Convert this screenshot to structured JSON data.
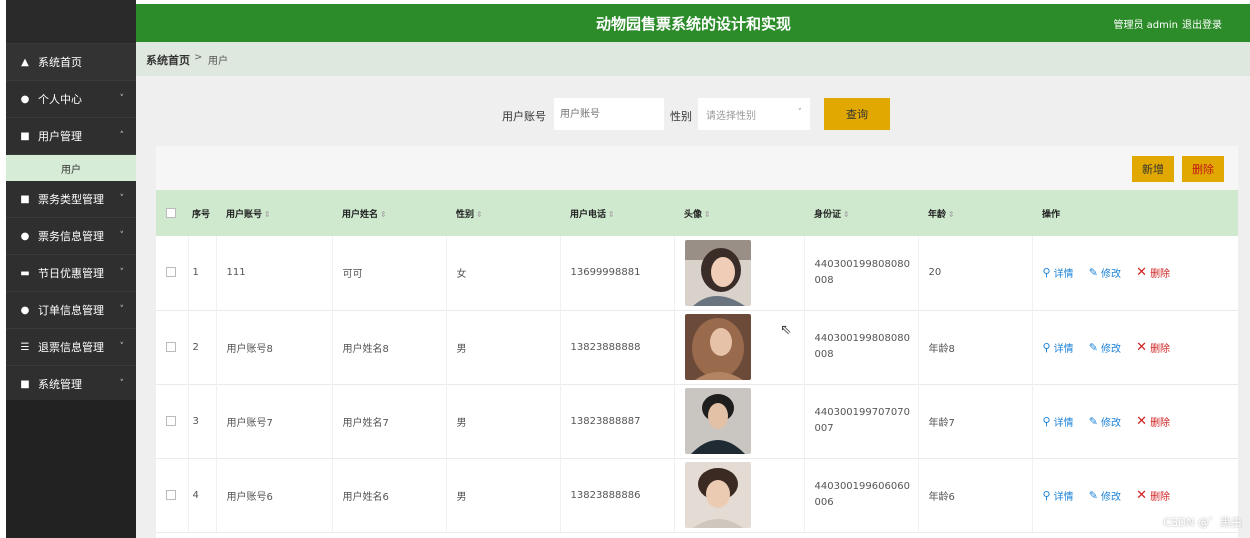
{
  "app": {
    "title": "动物园售票系统的设计和实现",
    "user_label": "管理员 admin",
    "logout_label": "退出登录"
  },
  "sidebar": {
    "items": [
      {
        "icon": "home-icon",
        "glyph": "▲",
        "label": "系统首页",
        "chevron": ""
      },
      {
        "icon": "person-icon",
        "glyph": "●",
        "label": "个人中心",
        "chevron": "˅"
      },
      {
        "icon": "grid-icon",
        "glyph": "■",
        "label": "用户管理",
        "chevron": "˄"
      },
      {
        "icon": "grid-icon",
        "glyph": "■",
        "label": "票务类型管理",
        "chevron": "˅"
      },
      {
        "icon": "person-icon",
        "glyph": "●",
        "label": "票务信息管理",
        "chevron": "˅"
      },
      {
        "icon": "inbox-icon",
        "glyph": "▬",
        "label": "节日优惠管理",
        "chevron": "˅"
      },
      {
        "icon": "location-icon",
        "glyph": "●",
        "label": "订单信息管理",
        "chevron": "˅"
      },
      {
        "icon": "sliders-icon",
        "glyph": "☰",
        "label": "退票信息管理",
        "chevron": "˅"
      },
      {
        "icon": "grid-icon",
        "glyph": "■",
        "label": "系统管理",
        "chevron": "˅"
      }
    ],
    "sub_item": "用户"
  },
  "breadcrumb": {
    "home": "系统首页",
    "separator": ">",
    "current": "用户"
  },
  "search": {
    "account_label": "用户账号",
    "account_placeholder": "用户账号",
    "gender_label": "性别",
    "gender_placeholder": "请选择性别",
    "query_label": "查询"
  },
  "toolbar": {
    "add_label": "新增",
    "delete_label": "删除"
  },
  "table": {
    "headers": [
      "序号",
      "用户账号",
      "用户姓名",
      "性别",
      "用户电话",
      "头像",
      "身份证",
      "年龄",
      "操作"
    ],
    "rows": [
      {
        "index": "1",
        "account": "111",
        "name": "可可",
        "gender": "女",
        "phone": "13699998881",
        "id_card": "440300199808080008",
        "age": "20"
      },
      {
        "index": "2",
        "account": "用户账号8",
        "name": "用户姓名8",
        "gender": "男",
        "phone": "13823888888",
        "id_card": "440300199808080008",
        "age": "年龄8"
      },
      {
        "index": "3",
        "account": "用户账号7",
        "name": "用户姓名7",
        "gender": "男",
        "phone": "13823888887",
        "id_card": "440300199707070007",
        "age": "年龄7"
      },
      {
        "index": "4",
        "account": "用户账号6",
        "name": "用户姓名6",
        "gender": "男",
        "phone": "13823888886",
        "id_card": "440300199606060006",
        "age": "年龄6"
      }
    ],
    "ops": {
      "view": "详情",
      "edit": "修改",
      "delete": "删除"
    }
  },
  "watermark": "CSDN @゛黑白",
  "colors": {
    "header_green": "#2c8c2a",
    "accent_yellow": "#e0a800",
    "table_header": "#cfe9cf",
    "sidebar_dark": "#2f2f2f"
  }
}
